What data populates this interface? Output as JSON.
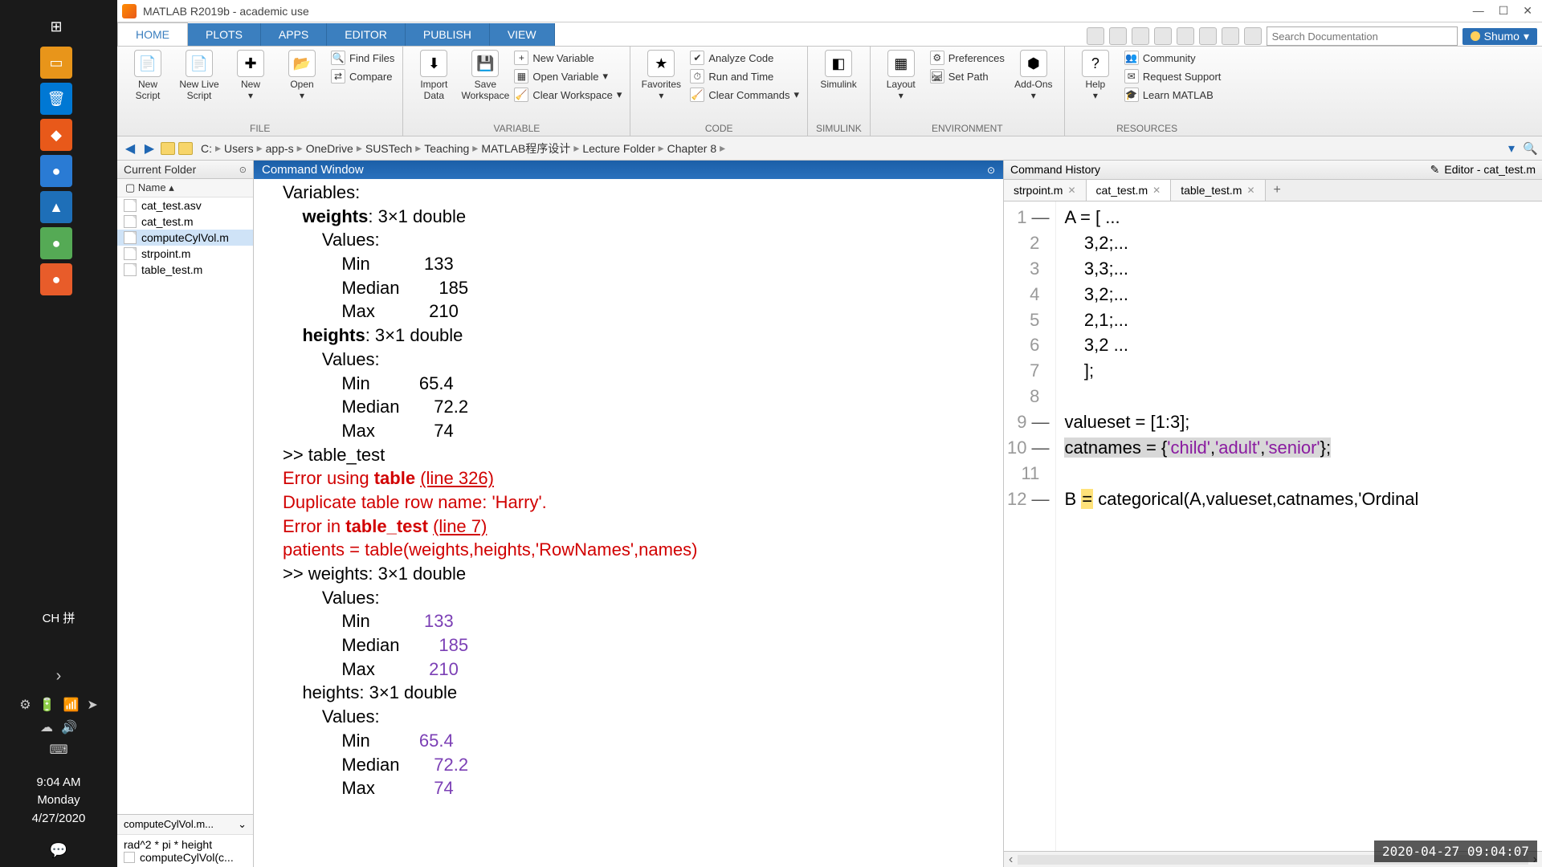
{
  "taskbar": {
    "ime": "CH 拼",
    "time": "9:04 AM",
    "day": "Monday",
    "date": "4/27/2020"
  },
  "title": "MATLAB R2019b - academic use",
  "tabs": [
    "HOME",
    "PLOTS",
    "APPS",
    "EDITOR",
    "PUBLISH",
    "VIEW"
  ],
  "search_placeholder": "Search Documentation",
  "user": "Shumo",
  "ribbon": {
    "file": {
      "label": "FILE",
      "new_script": "New Script",
      "new_live": "New Live Script",
      "new": "New",
      "open": "Open",
      "find_files": "Find Files",
      "compare": "Compare"
    },
    "variable": {
      "label": "VARIABLE",
      "import": "Import Data",
      "save_ws": "Save Workspace",
      "new_var": "New Variable",
      "open_var": "Open Variable",
      "clear_ws": "Clear Workspace"
    },
    "code": {
      "label": "CODE",
      "favorites": "Favorites",
      "analyze": "Analyze Code",
      "run_time": "Run and Time",
      "clear_cmd": "Clear Commands"
    },
    "simulink": {
      "label": "SIMULINK",
      "btn": "Simulink"
    },
    "environment": {
      "label": "ENVIRONMENT",
      "layout": "Layout",
      "prefs": "Preferences",
      "set_path": "Set Path",
      "addons": "Add-Ons"
    },
    "resources": {
      "label": "RESOURCES",
      "help": "Help",
      "community": "Community",
      "support": "Request Support",
      "learn": "Learn MATLAB"
    }
  },
  "breadcrumbs": [
    "C:",
    "Users",
    "app-s",
    "OneDrive",
    "SUSTech",
    "Teaching",
    "MATLAB程序设计",
    "Lecture Folder",
    "Chapter 8"
  ],
  "current_folder": {
    "title": "Current Folder",
    "col": "Name",
    "files": [
      "cat_test.asv",
      "cat_test.m",
      "computeCylVol.m",
      "strpoint.m",
      "table_test.m"
    ],
    "selected": "computeCylVol.m",
    "detail_file": "computeCylVol.m...",
    "detail_expr": "rad^2 * pi * height",
    "detail_fn": "computeCylVol(c..."
  },
  "command_window": {
    "title": "Command Window",
    "lines": [
      {
        "t": "Variables:"
      },
      {
        "t": "    weights: 3×1 double",
        "cls": "b-ind",
        "bold_word": "weights"
      },
      {
        "t": "        Values:"
      },
      {
        "t": "            Min           133"
      },
      {
        "t": "            Median        185"
      },
      {
        "t": "            Max           210"
      },
      {
        "t": "    heights: 3×1 double",
        "bold_word": "heights"
      },
      {
        "t": "        Values:"
      },
      {
        "t": "            Min          65.4"
      },
      {
        "t": "            Median       72.2"
      },
      {
        "t": "            Max            74"
      },
      {
        "t": ">> table_test"
      },
      {
        "err": true,
        "parts": [
          "Error using ",
          {
            "b": "table"
          },
          " ",
          {
            "u": "(line 326)"
          }
        ]
      },
      {
        "err": true,
        "parts": [
          "Duplicate table row name: 'Harry'."
        ]
      },
      {
        "err": true,
        "parts": [
          "Error in ",
          {
            "b": "table_test"
          },
          " ",
          {
            "u": "(line 7)"
          }
        ]
      },
      {
        "err": true,
        "parts": [
          "patients = table(weights,heights,'RowNames',names)"
        ]
      },
      {
        "fx": true,
        "t": ">> weights: 3×1 double"
      },
      {
        "t": "        Values:"
      },
      {
        "num": true,
        "t": "            Min           133",
        "numpart": "133"
      },
      {
        "num": true,
        "t": "            Median        185",
        "numpart": "185"
      },
      {
        "num": true,
        "t": "            Max           210",
        "numpart": "210"
      },
      {
        "t": "    heights: 3×1 double"
      },
      {
        "t": "        Values:"
      },
      {
        "num": true,
        "t": "            Min          65.4",
        "numpart": "65.4"
      },
      {
        "num": true,
        "t": "            Median       72.2",
        "numpart": "72.2"
      },
      {
        "num": true,
        "t": "            Max            74",
        "numpart": "74"
      }
    ]
  },
  "cmd_history_title": "Command History",
  "editor": {
    "title": "Editor - cat_test.m",
    "tabs": [
      {
        "name": "strpoint.m"
      },
      {
        "name": "cat_test.m",
        "active": true
      },
      {
        "name": "table_test.m"
      }
    ],
    "lines": [
      {
        "n": 1,
        "dash": true,
        "code": "A = [ ..."
      },
      {
        "n": 2,
        "code": "    3,2;..."
      },
      {
        "n": 3,
        "code": "    3,3;..."
      },
      {
        "n": 4,
        "code": "    3,2;..."
      },
      {
        "n": 5,
        "code": "    2,1;..."
      },
      {
        "n": 6,
        "code": "    3,2 ..."
      },
      {
        "n": 7,
        "code": "    ];"
      },
      {
        "n": 8,
        "code": ""
      },
      {
        "n": 9,
        "dash": true,
        "code": "valueset = [1:3];"
      },
      {
        "n": 10,
        "dash": true,
        "hl": true,
        "code": "catnames = {'child','adult','senior'};"
      },
      {
        "n": 11,
        "code": ""
      },
      {
        "n": 12,
        "dash": true,
        "warn": true,
        "code": "B = categorical(A,valueset,catnames,'Ordinal"
      }
    ]
  },
  "datestamp": "2020-04-27 09:04:07"
}
